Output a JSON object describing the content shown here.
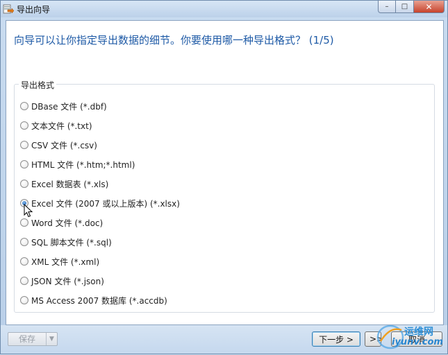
{
  "window": {
    "title": "导出向导",
    "minimize_label": "–",
    "maximize_label": "□",
    "close_label": "✕"
  },
  "heading": "向导可以让你指定导出数据的细节。你要使用哪一种导出格式？ (1/5)",
  "group_label": "导出格式",
  "options": [
    {
      "label": "DBase 文件 (*.dbf)",
      "checked": false
    },
    {
      "label": "文本文件 (*.txt)",
      "checked": false
    },
    {
      "label": "CSV 文件 (*.csv)",
      "checked": false
    },
    {
      "label": "HTML 文件 (*.htm;*.html)",
      "checked": false
    },
    {
      "label": "Excel 数据表 (*.xls)",
      "checked": false
    },
    {
      "label": "Excel 文件 (2007 或以上版本) (*.xlsx)",
      "checked": true
    },
    {
      "label": "Word 文件 (*.doc)",
      "checked": false
    },
    {
      "label": "SQL 脚本文件 (*.sql)",
      "checked": false
    },
    {
      "label": "XML 文件 (*.xml)",
      "checked": false
    },
    {
      "label": "JSON 文件 (*.json)",
      "checked": false
    },
    {
      "label": "MS Access 2007 数据库 (*.accdb)",
      "checked": false
    }
  ],
  "footer": {
    "save_label": "保存",
    "save_dropdown_icon": "chevron-down-icon",
    "next_label": "下一步 >",
    "last_label": ">>",
    "cancel_label": "取消"
  },
  "watermark": {
    "cn": "运维网",
    "en": "iyunv.com"
  },
  "colors": {
    "heading": "#1e5aa6",
    "window_frame": "#b9cfe8",
    "close_button": "#c7432c"
  }
}
